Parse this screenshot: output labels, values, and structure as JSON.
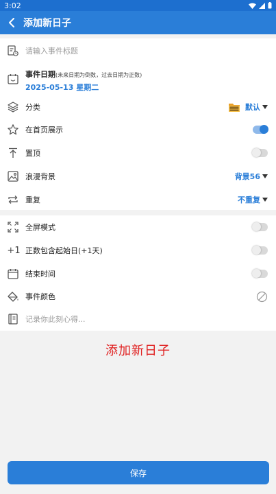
{
  "status": {
    "time": "3:02"
  },
  "appbar": {
    "title": "添加新日子"
  },
  "form": {
    "title_placeholder": "请输入事件标题",
    "date_label": "事件日期",
    "date_hint": "(未来日期为倒数，过去日期为正数)",
    "date_value": "2025-05-13 星期二",
    "category_label": "分类",
    "category_value": "默认",
    "home_label": "在首页展示",
    "home_on": true,
    "top_label": "置顶",
    "top_on": false,
    "bg_label": "浪漫背景",
    "bg_value": "背景56",
    "repeat_label": "重复",
    "repeat_value": "不重复",
    "fullscreen_label": "全屏模式",
    "fullscreen_on": false,
    "plus_one_glyph": "+1",
    "count_start_label": "正数包含起始日(+1天)",
    "count_start_on": false,
    "end_time_label": "结束时间",
    "end_time_on": false,
    "color_label": "事件颜色",
    "note_placeholder": "记录你此刻心得..."
  },
  "caption": "添加新日子",
  "save_label": "保存",
  "colors": {
    "primary": "#2a7ed8",
    "statusbar": "#1d6fcf",
    "caption": "#e02020"
  }
}
